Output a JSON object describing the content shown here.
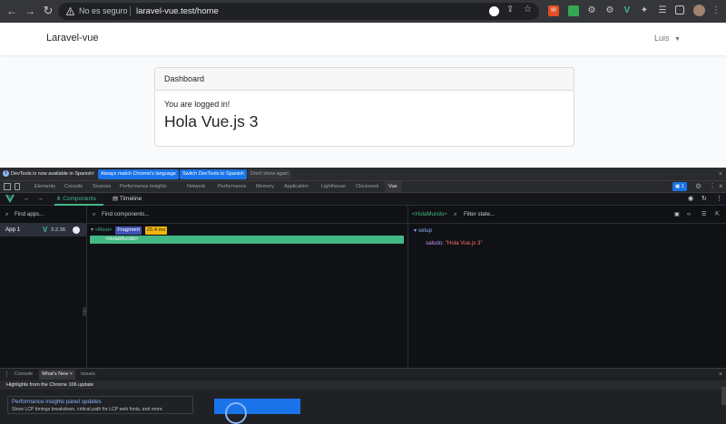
{
  "browser": {
    "security_text": "No es seguro",
    "url": "laravel-vue.test/home",
    "back_glyph": "←",
    "forward_glyph": "→",
    "reload_glyph": "↻",
    "menu_glyph": "⋮"
  },
  "app": {
    "brand": "Laravel-vue",
    "user": "Luis",
    "card_header": "Dashboard",
    "logged_text": "You are logged in!",
    "heading": "Hola Vue.js 3"
  },
  "devtools": {
    "infobar": {
      "message": "DevTools is now available in Spanish!",
      "match_btn": "Always match Chrome's language",
      "switch_btn": "Switch DevTools to Spanish",
      "dismiss_btn": "Don't show again"
    },
    "tabs": [
      "Elements",
      "Console",
      "Sources",
      "Performance insights",
      "Network",
      "Performance",
      "Memory",
      "Application",
      "Lighthouse",
      "Clockwork",
      "Vue"
    ],
    "issues_count": "1",
    "vue": {
      "components_tab": "Components",
      "timeline_tab": "Timeline",
      "find_apps_placeholder": "Find apps...",
      "find_components_placeholder": "Find components...",
      "app_name": "App 1",
      "vue_version": "3.2.36",
      "root_label": "Root",
      "fragment_badge": "Fragment",
      "time_badge": "25.4 ms",
      "component_name": "<HolaMundo>",
      "selected_component": "<HolaMundo>",
      "filter_state_placeholder": "Filter state...",
      "state_section": "setup",
      "state_key": "saludo",
      "state_value": "\"Hola Vue.js 3\""
    },
    "drawer": {
      "tabs": [
        "Console",
        "What's New",
        "Issues"
      ],
      "highlights": "Highlights from the Chrome 106 update",
      "card_title": "Performance insights panel updates",
      "card_desc": "Show LCP timings breakdown, critical path for LCP web fonts, and more."
    }
  },
  "colors": {
    "vue_green": "#42b883",
    "fragment_badge": "#3f51b5",
    "time_badge": "#f5b50a",
    "string_value": "#ff6b6b",
    "info_btn_blue": "#1a73e8"
  }
}
